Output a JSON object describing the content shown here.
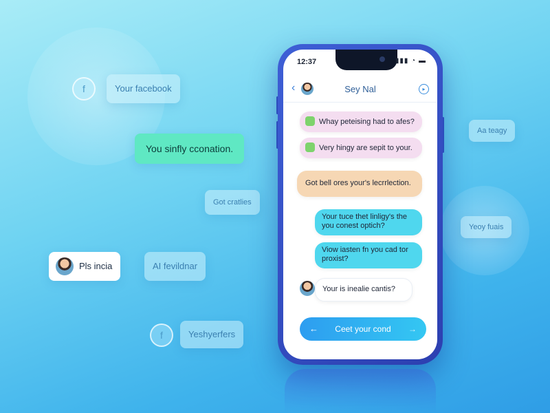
{
  "floating": {
    "facebook_bubble": "Your facebook",
    "green_bubble": "You sinfly cconation.",
    "grey_bubble_1": "Got cratlies",
    "profile_bubble": "Pls incia",
    "ai_bubble": "AI fevildnar",
    "bottom_bubble": "Yeshyerfers",
    "right_top_bubble": "Aa teagy",
    "right_mid_bubble": "Yeoy fuais"
  },
  "phone": {
    "status_time": "12:37",
    "status_icons": "▮▮▮ ◔ ▬",
    "title": "Sey Nal",
    "messages": [
      {
        "text": "Whay peteising had to afes?"
      },
      {
        "text": "Very hingy are sepit to your."
      },
      {
        "text": "Got bell ores your's lecrrlection."
      },
      {
        "text": "Your tuce thet linligy's the you conest optich?"
      },
      {
        "text": "Viow iasten fn you cad tor proxist?"
      },
      {
        "text": "Your is inealie cantis?"
      }
    ],
    "cta": "Ceet your cond"
  },
  "colors": {
    "accent": "#2d9df0",
    "phone_frame": "#2c3fb0",
    "green_bubble": "#5fe8c3",
    "pink_message": "#f4ddf0",
    "peach_message": "#f6d7b4",
    "cyan_message": "#4fd7ee"
  },
  "icons": [
    "facebook-icon",
    "back-icon",
    "info-icon",
    "arrow-left-icon",
    "arrow-right-icon",
    "avatar-icon"
  ]
}
